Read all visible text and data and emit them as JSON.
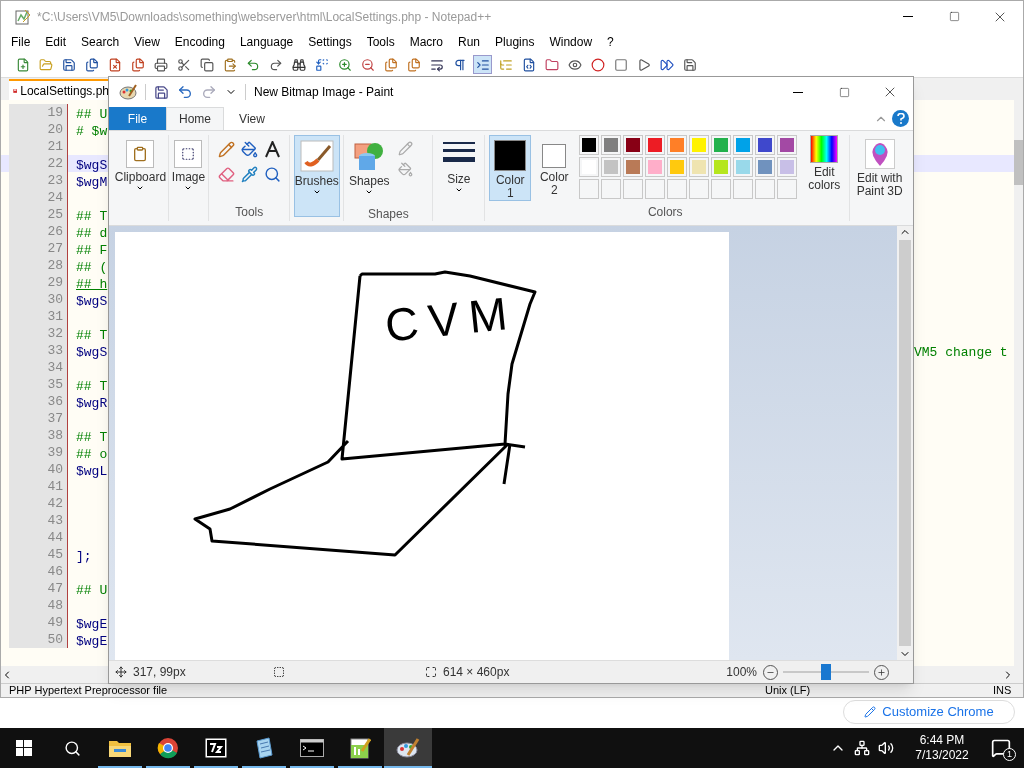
{
  "notepad": {
    "title": "*C:\\Users\\VM5\\Downloads\\something\\webserver\\html\\LocalSettings.php - Notepad++",
    "menu": [
      "File",
      "Edit",
      "Search",
      "View",
      "Encoding",
      "Language",
      "Settings",
      "Tools",
      "Macro",
      "Run",
      "Plugins",
      "Window",
      "?"
    ],
    "tab": {
      "label": "LocalSettings.ph",
      "modified": true
    },
    "lines": [
      {
        "number": "19",
        "text": "## U",
        "kind": "comment",
        "current": false
      },
      {
        "number": "20",
        "text": "# $w",
        "kind": "comment",
        "current": false
      },
      {
        "number": "21",
        "current": false
      },
      {
        "number": "22",
        "text": "$wgS",
        "kind": "variable",
        "current": true
      },
      {
        "number": "23",
        "text": "$wgM",
        "kind": "variable",
        "current": false
      },
      {
        "number": "24",
        "current": false
      },
      {
        "number": "25",
        "text": "## T",
        "kind": "comment",
        "current": false
      },
      {
        "number": "26",
        "text": "## d",
        "kind": "comment",
        "current": false
      },
      {
        "number": "27",
        "text": "## F",
        "kind": "comment",
        "current": false
      },
      {
        "number": "28",
        "text": "## (",
        "kind": "comment",
        "current": false
      },
      {
        "number": "29",
        "text": "## h",
        "kind": "link",
        "current": false
      },
      {
        "number": "30",
        "text": "$wgS",
        "kind": "variable",
        "current": false
      },
      {
        "number": "31",
        "current": false
      },
      {
        "number": "32",
        "text": "## T",
        "kind": "comment",
        "current": false
      },
      {
        "number": "33",
        "text": "$wgS",
        "kind": "variable",
        "current": false,
        "right_text": "VM5 change t"
      },
      {
        "number": "34",
        "current": false
      },
      {
        "number": "35",
        "text": "## T",
        "kind": "comment",
        "current": false
      },
      {
        "number": "36",
        "text": "$wgR",
        "kind": "variable",
        "current": false
      },
      {
        "number": "37",
        "current": false
      },
      {
        "number": "38",
        "text": "## T",
        "kind": "comment",
        "current": false
      },
      {
        "number": "39",
        "text": "## o",
        "kind": "comment",
        "current": false
      },
      {
        "number": "40",
        "text": "$wgL",
        "kind": "variable",
        "current": false
      },
      {
        "number": "41",
        "current": false
      },
      {
        "number": "42",
        "current": false
      },
      {
        "number": "43",
        "current": false
      },
      {
        "number": "44",
        "current": false
      },
      {
        "number": "45",
        "text": "];",
        "kind": "plain",
        "current": false
      },
      {
        "number": "46",
        "current": false
      },
      {
        "number": "47",
        "text": "## U",
        "kind": "comment",
        "current": false
      },
      {
        "number": "48",
        "current": false
      },
      {
        "number": "49",
        "text": "$wgE",
        "kind": "variable",
        "current": false
      },
      {
        "number": "50",
        "text": "$wgE",
        "kind": "variable",
        "current": false
      }
    ],
    "status_bar": {
      "file_type": "PHP Hypertext Preprocessor file",
      "eol": "Unix (LF)",
      "mode": "INS"
    }
  },
  "chrome": {
    "button": "Customize Chrome"
  },
  "paint": {
    "title": "New Bitmap Image - Paint",
    "tabs": [
      {
        "label": "File",
        "kind": "file",
        "selected": false
      },
      {
        "label": "Home",
        "kind": "tab",
        "selected": true
      },
      {
        "label": "View",
        "kind": "tab",
        "selected": false
      }
    ],
    "ribbon": {
      "clipboard": "Clipboard",
      "image": "Image",
      "tools_label": "Tools",
      "brushes": {
        "label": "Brushes",
        "selected": true
      },
      "shapes": "Shapes",
      "shapes_label": "Shapes",
      "size": "Size",
      "color1": {
        "label": "Color 1",
        "color": "#000000",
        "selected": true
      },
      "color2": {
        "label": "Color 2",
        "color": "#ffffff",
        "selected": false
      },
      "palette": [
        [
          {
            "color": "#000000"
          },
          {
            "color": "#7f7f7f"
          },
          {
            "color": "#880015"
          },
          {
            "color": "#ed1c24"
          },
          {
            "color": "#ff7f27"
          },
          {
            "color": "#fff200"
          },
          {
            "color": "#22b14c"
          },
          {
            "color": "#00a2e8"
          },
          {
            "color": "#3f48cc"
          },
          {
            "color": "#a349a4"
          }
        ],
        [
          {
            "color": "#ffffff"
          },
          {
            "color": "#c3c3c3"
          },
          {
            "color": "#b97a57"
          },
          {
            "color": "#ffaec9"
          },
          {
            "color": "#ffc90e"
          },
          {
            "color": "#efe4b0"
          },
          {
            "color": "#b5e61d"
          },
          {
            "color": "#99d9ea"
          },
          {
            "color": "#7092be"
          },
          {
            "color": "#c8bfe7"
          }
        ],
        [
          {
            "empty": true
          },
          {
            "empty": true
          },
          {
            "empty": true
          },
          {
            "empty": true
          },
          {
            "empty": true
          },
          {
            "empty": true
          },
          {
            "empty": true
          },
          {
            "empty": true
          },
          {
            "empty": true
          },
          {
            "empty": true
          }
        ]
      ],
      "edit_colors": "Edit colors",
      "colors_label": "Colors",
      "paint3d": "Edit with Paint 3D"
    },
    "canvas": {
      "text": "CVM"
    },
    "status_bar": {
      "cursor": "317, 99px",
      "size": "614 × 460px",
      "zoom": "100%",
      "zoom_slider": {
        "level": 0.5
      }
    }
  },
  "taskbar": {
    "apps": [
      {
        "kind": "folder",
        "selected": false
      },
      {
        "kind": "browser",
        "selected": false
      },
      {
        "kind": "archiver",
        "selected": false
      },
      {
        "kind": "notepad",
        "selected": false
      },
      {
        "kind": "terminal",
        "selected": false
      },
      {
        "kind": "editor",
        "selected": false
      },
      {
        "kind": "paint",
        "selected": true
      }
    ],
    "time": "6:44 PM",
    "date": "7/13/2022",
    "notifications": "1"
  }
}
